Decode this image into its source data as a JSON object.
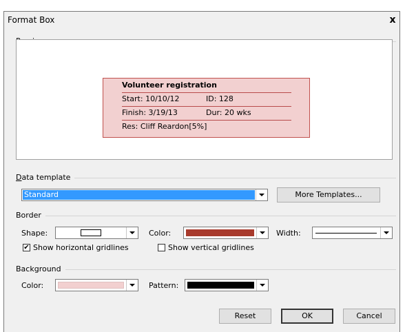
{
  "dialog": {
    "title": "Format Box",
    "close_glyph": "x"
  },
  "preview": {
    "group_label": "Preview",
    "card": {
      "title": "Volunteer registration",
      "start": "Start:  10/10/12",
      "id": "ID:  128",
      "finish": "Finish: 3/19/13",
      "dur": "Dur: 20 wks",
      "res": "Res:   Cliff Reardon[5%]"
    },
    "card_fill": "#f2d0d0",
    "card_border": "#c0504d"
  },
  "data_template": {
    "group_label_first": "D",
    "group_label_rest": "ata template",
    "selected": "Standard",
    "more_button": "More Templates..."
  },
  "border": {
    "group_label": "Border",
    "shape_label": "Shape:",
    "color_label": "Color:",
    "color_value": "#a83a2c",
    "width_label": "Width:",
    "horiz_check_label": "Show horizontal gridlines",
    "horiz_checked": "✔",
    "vert_check_label": "Show vertical gridlines"
  },
  "background": {
    "group_label": "Background",
    "color_label": "Color:",
    "color_value": "#f2d0d0",
    "pattern_label": "Pattern:",
    "pattern_value": "#000000"
  },
  "buttons": {
    "reset": "Reset",
    "ok": "OK",
    "cancel": "Cancel"
  }
}
